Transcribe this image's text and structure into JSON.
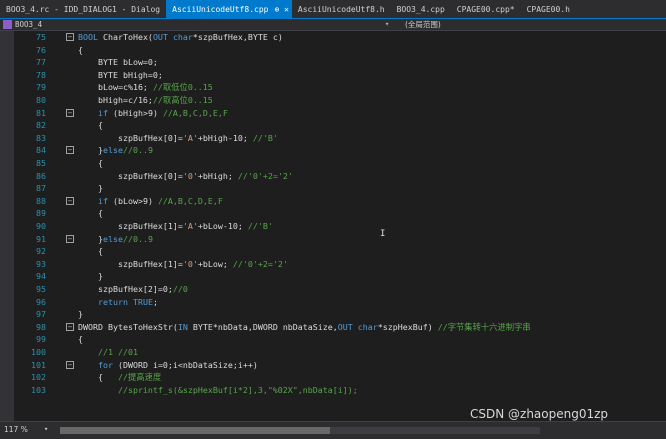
{
  "tabs": [
    {
      "label": "BOO3_4.rc - IDD_DIALOG1 - Dialog",
      "active": false
    },
    {
      "label": "AsciiUnicodeUtf8.cpp",
      "active": true,
      "icons": "⊕ ✕"
    },
    {
      "label": "AsciiUnicodeUtf8.h",
      "active": false
    },
    {
      "label": "BOO3_4.cpp",
      "active": false
    },
    {
      "label": "CPAGE00.cpp*",
      "active": false
    },
    {
      "label": "CPAGE00.h",
      "active": false
    }
  ],
  "navbar": {
    "project": "BOO3_4",
    "caret": "▾",
    "scope": "(全局范围)"
  },
  "lines": [
    {
      "n": "75",
      "fold": "⊟",
      "segs": [
        [
          "kw",
          "BOOL"
        ],
        [
          "pl",
          " CharToHex("
        ],
        [
          "kw",
          "OUT"
        ],
        [
          "pl",
          " "
        ],
        [
          "kw",
          "char"
        ],
        [
          "pl",
          "*szpBufHex,BYTE c)"
        ]
      ]
    },
    {
      "n": "76",
      "fold": "",
      "segs": [
        [
          "pl",
          "{"
        ]
      ]
    },
    {
      "n": "77",
      "fold": "",
      "segs": [
        [
          "pl",
          "    BYTE bLow=0;"
        ]
      ]
    },
    {
      "n": "78",
      "fold": "",
      "segs": [
        [
          "pl",
          "    BYTE bHigh=0;"
        ]
      ]
    },
    {
      "n": "79",
      "fold": "",
      "segs": [
        [
          "pl",
          "    bLow=c%16; "
        ],
        [
          "cm",
          "//取低位0..15"
        ]
      ]
    },
    {
      "n": "80",
      "fold": "",
      "segs": [
        [
          "pl",
          "    bHigh=c/16;"
        ],
        [
          "cm",
          "//取高位0..15"
        ]
      ]
    },
    {
      "n": "81",
      "fold": "⊟",
      "segs": [
        [
          "pl",
          "    "
        ],
        [
          "kw",
          "if"
        ],
        [
          "pl",
          " (bHigh>9) "
        ],
        [
          "cm",
          "//A,B,C,D,E,F"
        ]
      ]
    },
    {
      "n": "82",
      "fold": "",
      "segs": [
        [
          "pl",
          "    {"
        ]
      ]
    },
    {
      "n": "83",
      "fold": "",
      "segs": [
        [
          "pl",
          "        szpBufHex[0]="
        ],
        [
          "st",
          "'A'"
        ],
        [
          "pl",
          "+bHigh-10; "
        ],
        [
          "cm",
          "//'B'"
        ]
      ]
    },
    {
      "n": "84",
      "fold": "⊟",
      "segs": [
        [
          "pl",
          "    }"
        ],
        [
          "kw",
          "else"
        ],
        [
          "cm",
          "//0..9"
        ]
      ]
    },
    {
      "n": "85",
      "fold": "",
      "segs": [
        [
          "pl",
          "    {"
        ]
      ]
    },
    {
      "n": "86",
      "fold": "",
      "segs": [
        [
          "pl",
          "        szpBufHex[0]="
        ],
        [
          "st",
          "'0'"
        ],
        [
          "pl",
          "+bHigh; "
        ],
        [
          "cm",
          "//'0'+2='2'"
        ]
      ]
    },
    {
      "n": "87",
      "fold": "",
      "segs": [
        [
          "pl",
          "    }"
        ]
      ]
    },
    {
      "n": "88",
      "fold": "⊟",
      "segs": [
        [
          "pl",
          "    "
        ],
        [
          "kw",
          "if"
        ],
        [
          "pl",
          " (bLow>9) "
        ],
        [
          "cm",
          "//A,B,C,D,E,F"
        ]
      ]
    },
    {
      "n": "89",
      "fold": "",
      "segs": [
        [
          "pl",
          "    {"
        ]
      ]
    },
    {
      "n": "90",
      "fold": "",
      "segs": [
        [
          "pl",
          "        szpBufHex[1]="
        ],
        [
          "st",
          "'A'"
        ],
        [
          "pl",
          "+bLow-10; "
        ],
        [
          "cm",
          "//'B'"
        ]
      ]
    },
    {
      "n": "91",
      "fold": "⊟",
      "segs": [
        [
          "pl",
          "    }"
        ],
        [
          "kw",
          "else"
        ],
        [
          "cm",
          "//0..9"
        ]
      ]
    },
    {
      "n": "92",
      "fold": "",
      "segs": [
        [
          "pl",
          "    {"
        ]
      ]
    },
    {
      "n": "93",
      "fold": "",
      "segs": [
        [
          "pl",
          "        szpBufHex[1]="
        ],
        [
          "st",
          "'0'"
        ],
        [
          "pl",
          "+bLow; "
        ],
        [
          "cm",
          "//'0'+2='2'"
        ]
      ]
    },
    {
      "n": "94",
      "fold": "",
      "segs": [
        [
          "pl",
          "    }"
        ]
      ]
    },
    {
      "n": "95",
      "fold": "",
      "segs": [
        [
          "pl",
          "    szpBufHex[2]=0;"
        ],
        [
          "cm",
          "//0"
        ]
      ]
    },
    {
      "n": "96",
      "fold": "",
      "segs": [
        [
          "pl",
          "    "
        ],
        [
          "kw",
          "return"
        ],
        [
          "pl",
          " "
        ],
        [
          "kw",
          "TRUE"
        ],
        [
          "pl",
          ";"
        ]
      ]
    },
    {
      "n": "97",
      "fold": "",
      "segs": [
        [
          "pl",
          "}"
        ]
      ]
    },
    {
      "n": "98",
      "fold": "⊟",
      "segs": [
        [
          "pl",
          "DWORD BytesToHexStr("
        ],
        [
          "kw",
          "IN"
        ],
        [
          "pl",
          " BYTE*nbData,DWORD nbDataSize,"
        ],
        [
          "kw",
          "OUT"
        ],
        [
          "pl",
          " "
        ],
        [
          "kw",
          "char"
        ],
        [
          "pl",
          "*szpHexBuf) "
        ],
        [
          "cm",
          "//字节集转十六进制字串"
        ]
      ]
    },
    {
      "n": "99",
      "fold": "",
      "segs": [
        [
          "pl",
          "{"
        ]
      ]
    },
    {
      "n": "100",
      "fold": "",
      "segs": [
        [
          "cm",
          "    //1 //01"
        ]
      ]
    },
    {
      "n": "101",
      "fold": "⊟",
      "segs": [
        [
          "pl",
          "    "
        ],
        [
          "kw",
          "for"
        ],
        [
          "pl",
          " (DWORD i=0;i<nbDataSize;i++)"
        ]
      ]
    },
    {
      "n": "102",
      "fold": "",
      "segs": [
        [
          "pl",
          "    {   "
        ],
        [
          "cm",
          "//提高速度"
        ]
      ]
    },
    {
      "n": "103",
      "fold": "",
      "segs": [
        [
          "cm",
          "        //sprintf_s(&szpHexBuf[i*2],3,\"%02X\",nbData[i]);"
        ]
      ]
    }
  ],
  "watermark": "CSDN @zhaopeng01zp",
  "status": {
    "zoom": "117 %",
    "zoom_arrow": "▾"
  }
}
